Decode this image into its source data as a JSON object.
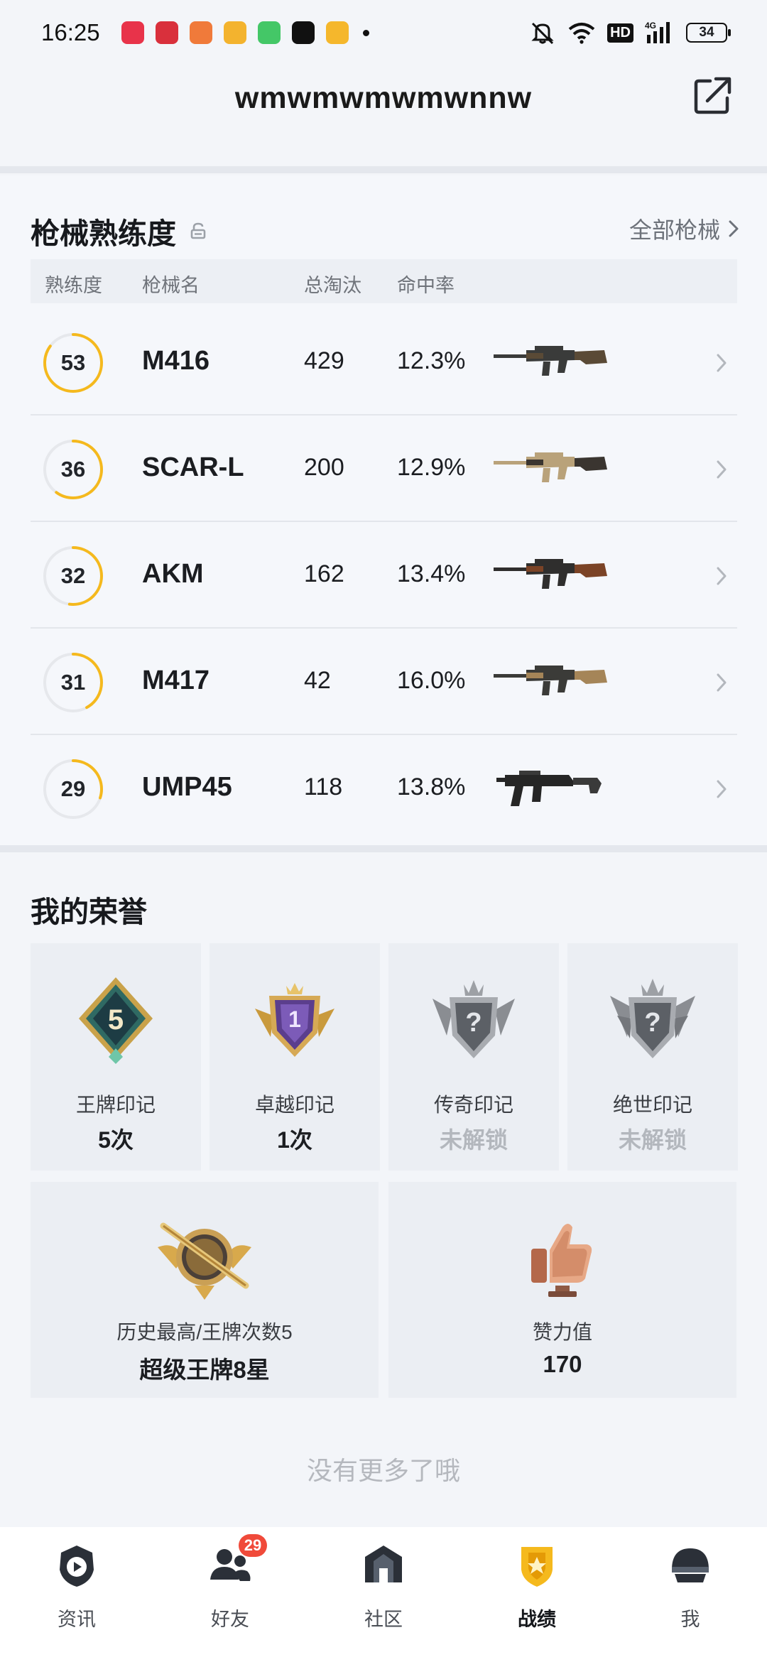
{
  "status_bar": {
    "time": "16:25",
    "hd": "HD",
    "battery": "34",
    "app_icon_colors": [
      "#e8334a",
      "#d9303c",
      "#f07a3a",
      "#f3b32e",
      "#44c767",
      "#111111",
      "#f5b72c"
    ]
  },
  "header": {
    "title": "wmwmwmwmwnnw",
    "share_icon": "share-out-icon"
  },
  "weapons": {
    "title": "枪械熟练度",
    "all_link": "全部枪械",
    "columns": [
      "熟练度",
      "枪械名",
      "总淘汰",
      "命中率"
    ],
    "rows": [
      {
        "level": "53",
        "progress": 0.85,
        "name": "M416",
        "kills": "429",
        "hit_rate": "12.3%",
        "gun_color": "#3a3b3a",
        "gun_accent": "#5a4a36"
      },
      {
        "level": "36",
        "progress": 0.6,
        "name": "SCAR-L",
        "kills": "200",
        "hit_rate": "12.9%",
        "gun_color": "#b9a27a",
        "gun_accent": "#3a3530"
      },
      {
        "level": "32",
        "progress": 0.52,
        "name": "AKM",
        "kills": "162",
        "hit_rate": "13.4%",
        "gun_color": "#2f2e2d",
        "gun_accent": "#7b4326"
      },
      {
        "level": "31",
        "progress": 0.42,
        "name": "M417",
        "kills": "42",
        "hit_rate": "16.0%",
        "gun_color": "#3b3b38",
        "gun_accent": "#a58558"
      },
      {
        "level": "29",
        "progress": 0.3,
        "name": "UMP45",
        "kills": "118",
        "hit_rate": "13.8%",
        "gun_color": "#262626",
        "gun_accent": "#3a3a3a"
      }
    ]
  },
  "honors": {
    "title": "我的荣誉",
    "badges": [
      {
        "name": "王牌印记",
        "value": "5次",
        "locked": false,
        "icon": "ace-mark-badge-icon"
      },
      {
        "name": "卓越印记",
        "value": "1次",
        "locked": false,
        "icon": "excellence-mark-badge-icon"
      },
      {
        "name": "传奇印记",
        "value": "未解锁",
        "locked": true,
        "icon": "legend-mark-badge-icon"
      },
      {
        "name": "绝世印记",
        "value": "未解锁",
        "locked": true,
        "icon": "peerless-mark-badge-icon"
      }
    ],
    "highest": {
      "label": "历史最高/王牌次数5",
      "value": "超级王牌8星",
      "icon": "super-ace-emblem-icon"
    },
    "likes": {
      "label": "赞力值",
      "value": "170",
      "icon": "thumbs-up-trophy-icon"
    },
    "footer": "没有更多了哦"
  },
  "nav": {
    "items": [
      {
        "label": "资讯",
        "icon": "news-play-icon"
      },
      {
        "label": "好友",
        "icon": "friends-icon",
        "badge": "29"
      },
      {
        "label": "社区",
        "icon": "community-house-icon"
      },
      {
        "label": "战绩",
        "icon": "record-shield-icon",
        "active": true
      },
      {
        "label": "我",
        "icon": "helmet-profile-icon"
      }
    ]
  },
  "colors": {
    "accent_yellow": "#f5b91d",
    "background": "#f3f5f9",
    "badge_red": "#f04a3a"
  }
}
